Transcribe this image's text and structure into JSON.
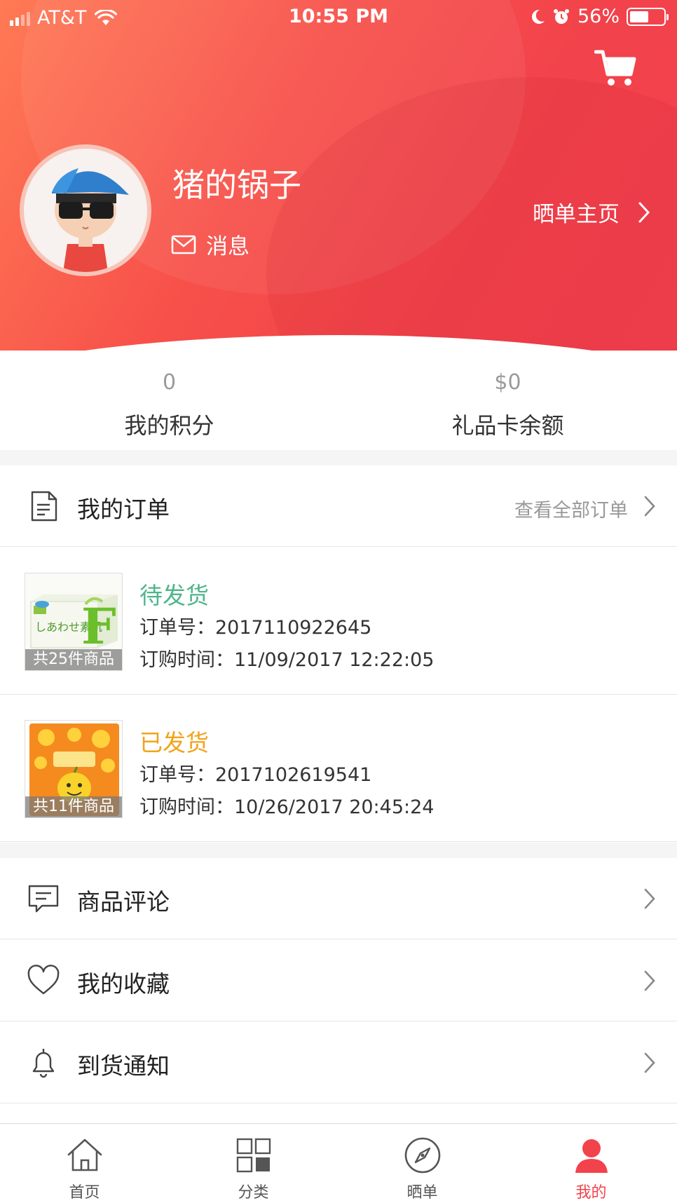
{
  "status_bar": {
    "carrier": "AT&T",
    "time": "10:55 PM",
    "battery": "56%",
    "battery_level": 0.56
  },
  "profile": {
    "username": "猪的锅子",
    "message_label": "消息",
    "show_home_label": "晒单主页"
  },
  "stats": {
    "points_value": "0",
    "points_label": "我的积分",
    "gift_value": "$0",
    "gift_label": "礼品卡余额"
  },
  "orders_section": {
    "title": "我的订单",
    "view_all": "查看全部订单"
  },
  "orders": [
    {
      "status": "待发货",
      "status_color": "#4fb58c",
      "order_no": "订单号：2017110922645",
      "order_time": "订购时间：11/09/2017 12:22:05",
      "count": "共25件商品"
    },
    {
      "status": "已发货",
      "status_color": "#f2a31a",
      "order_no": "订单号：2017102619541",
      "order_time": "订购时间：10/26/2017 20:45:24",
      "count": "共11件商品"
    }
  ],
  "menu": {
    "reviews": "商品评论",
    "favorites": "我的收藏",
    "notify": "到货通知"
  },
  "tabbar": {
    "home": "首页",
    "category": "分类",
    "show": "晒单",
    "mine": "我的",
    "active_color": "#f2424b"
  },
  "icons": {
    "cart": "cart-icon",
    "mail": "mail-icon",
    "order": "document-icon",
    "review": "comment-icon",
    "favorite": "heart-icon",
    "notify": "bell-icon",
    "home": "home-icon",
    "category": "grid-icon",
    "show": "compass-icon",
    "mine": "user-icon"
  },
  "colors": {
    "brand": "#f2424b",
    "header_start": "#ff7a55"
  }
}
